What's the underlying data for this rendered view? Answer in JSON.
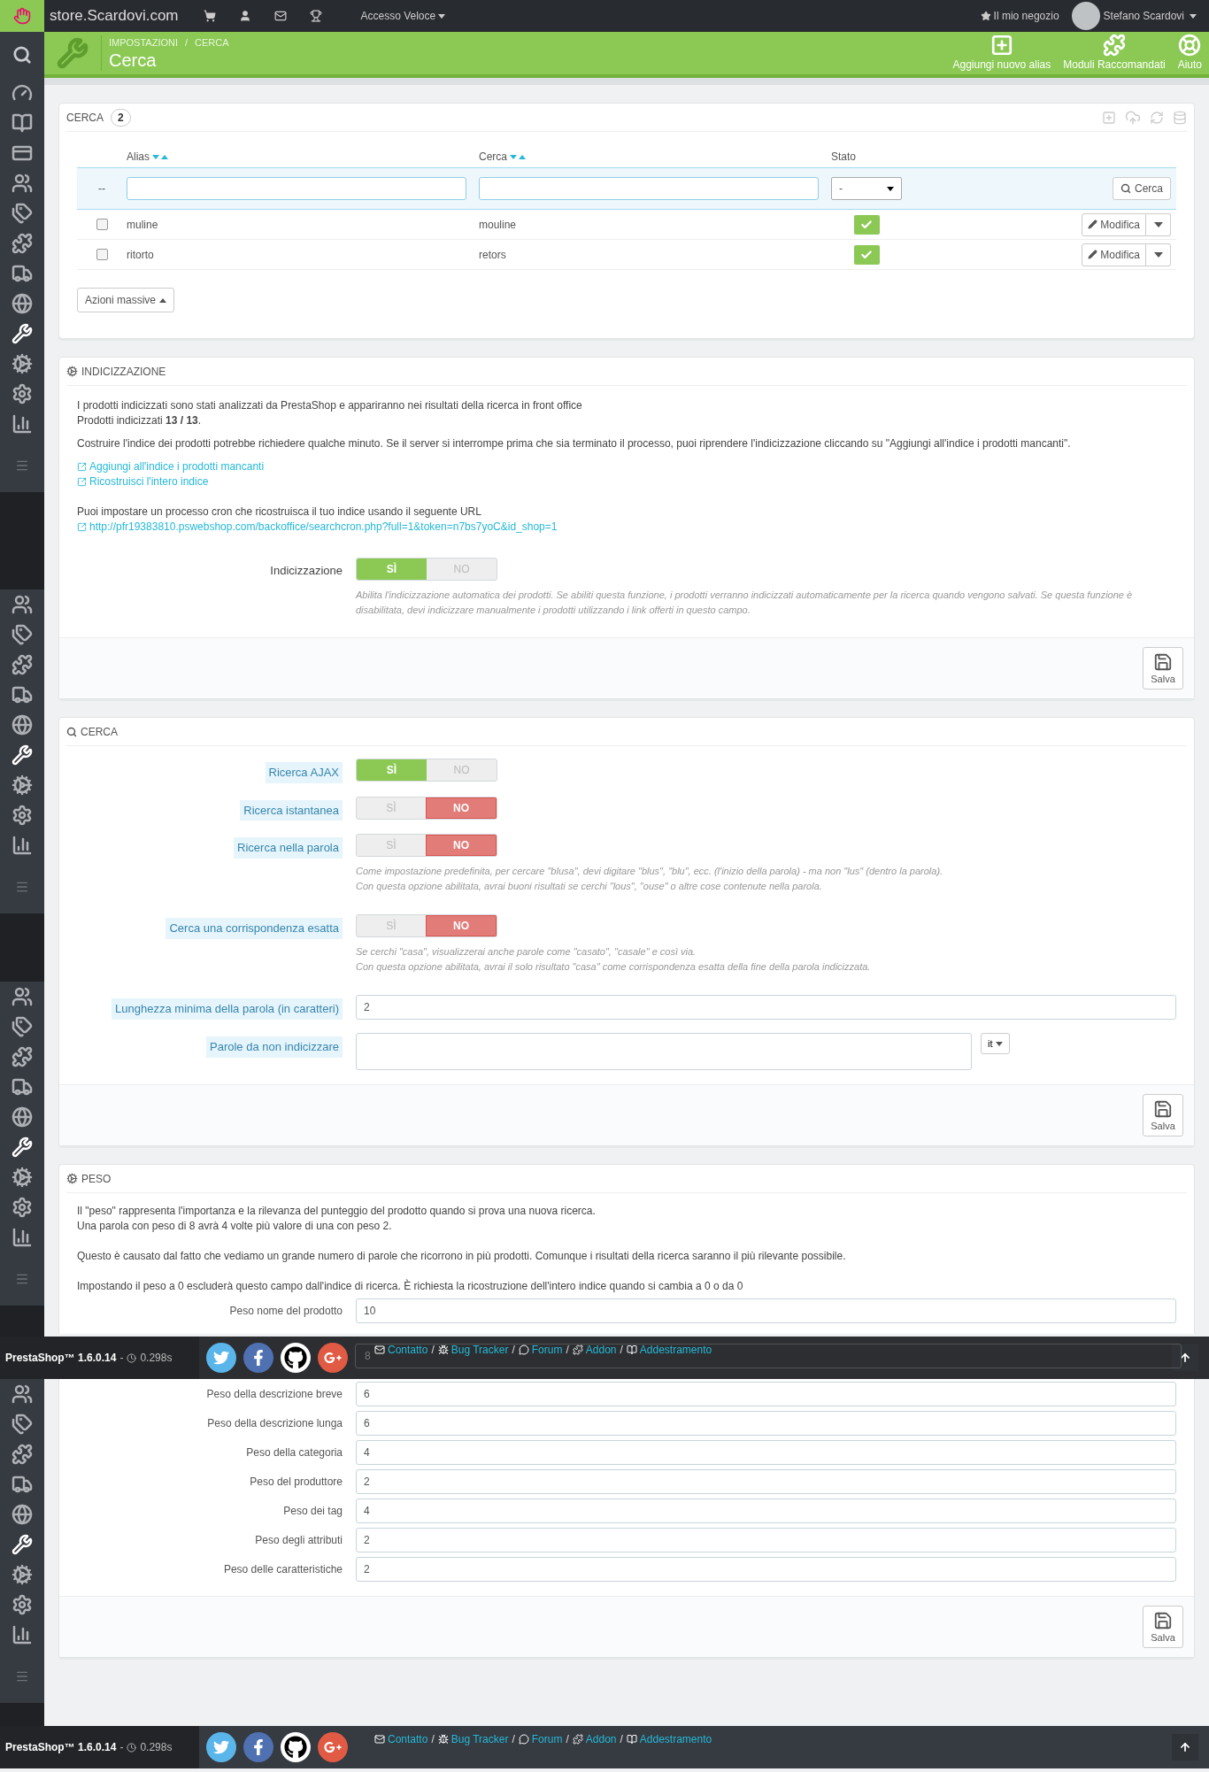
{
  "topbar": {
    "logo_text": "store.Scardovi.com",
    "quick_access": "Accesso Veloce",
    "shop_link": "Il mio negozio",
    "user": "Stefano Scardovi"
  },
  "sidebar": {
    "items": [
      {
        "kind": "dashboard",
        "selected": false
      },
      {
        "kind": "catalog",
        "selected": false
      },
      {
        "kind": "orders",
        "selected": false
      },
      {
        "kind": "customers",
        "selected": false
      },
      {
        "kind": "tags",
        "selected": false
      },
      {
        "kind": "modules",
        "selected": false
      },
      {
        "kind": "shipping",
        "selected": false
      },
      {
        "kind": "localization",
        "selected": false
      },
      {
        "kind": "preferences",
        "selected": true
      },
      {
        "kind": "advanced",
        "selected": false
      },
      {
        "kind": "administration",
        "selected": false
      },
      {
        "kind": "stats",
        "selected": false
      }
    ]
  },
  "page_header": {
    "breadcrumb": [
      "IMPOSTAZIONI",
      "CERCA"
    ],
    "breadcrumb_separator": "/",
    "title": "Cerca",
    "actions": [
      {
        "label": "Aggiungi nuovo alias",
        "kind": "add"
      },
      {
        "label": "Moduli Raccomandati",
        "kind": "modules"
      },
      {
        "label": "Aiuto",
        "kind": "help"
      }
    ]
  },
  "alias_panel": {
    "title": "CERCA",
    "count": "2",
    "columns": [
      {
        "label": "Alias",
        "sortable": true
      },
      {
        "label": "Cerca",
        "sortable": true
      },
      {
        "label": "Stato",
        "sortable": false
      }
    ],
    "filter": {
      "marker": "--",
      "status_value": "-",
      "button": "Cerca"
    },
    "rows": [
      {
        "alias": "muline",
        "search": "mouline",
        "active": true,
        "checked": false,
        "action": "Modifica"
      },
      {
        "alias": "ritorto",
        "search": "retors",
        "active": true,
        "checked": false,
        "action": "Modifica"
      }
    ],
    "bulk_button": "Azioni massive"
  },
  "index_panel": {
    "title": "INDICIZZAZIONE",
    "paragraphs": [
      "I prodotti indicizzati sono stati analizzati da PrestaShop e appariranno nei risultati della ricerca in front office",
      "Prodotti indicizzati **13 / 13**."
    ],
    "note": "Costruire l'indice dei prodotti potrebbe richiedere qualche minuto. Se il server si interrompe prima che sia terminato il processo, puoi riprendere l'indicizzazione cliccando su \"Aggiungi all'indice i prodotti mancanti\".",
    "links": [
      "Aggiungi all'indice i prodotti mancanti",
      "Ricostruisci l'intero indice"
    ],
    "cron_text": "Puoi impostare un processo cron che ricostruisca il tuo indice usando il seguente URL",
    "cron_url": "http://pfr19383810.pswebshop.com/backoffice/searchcron.php?full=1&token=n7bs7yoC&id_shop=1",
    "switch": {
      "label": "Indicizzazione",
      "yes": "SÌ",
      "no": "NO",
      "on": true,
      "help": [
        "Abilita l'indicizzazione automatica dei prodotti. Se abiliti questa funzione, i prodotti verranno indicizzati automaticamente per la ricerca quando vengono salvati. Se questa funzione è disabilitata, devi indicizzare manualmente i prodotti utilizzando i link offerti in questo campo."
      ]
    },
    "save": "Salva"
  },
  "search_panel": {
    "title": "CERCA",
    "fields": [
      {
        "kind": "switch",
        "label": "Ricerca AJAX",
        "yes": "SÌ",
        "no": "NO",
        "on": true
      },
      {
        "kind": "switch",
        "label": "Ricerca istantanea",
        "yes": "SÌ",
        "no": "NO",
        "on": false
      },
      {
        "kind": "switch",
        "label": "Ricerca nella parola",
        "yes": "SÌ",
        "no": "NO",
        "on": false,
        "help": [
          "Come impostazione predefinita, per cercare \"blusa\", devi digitare \"blus\", \"blu\", ecc. (l'inizio della parola) - ma non \"lus\" (dentro la parola).",
          "Con questa opzione abilitata, avrai buoni risultati se cerchi \"lous\", \"ouse\" o altre cose contenute nella parola."
        ]
      },
      {
        "kind": "switch",
        "label": "Cerca una corrispondenza esatta",
        "yes": "SÌ",
        "no": "NO",
        "on": false,
        "help": [
          "Se cerchi \"casa\", visualizzerai anche parole come \"casato\", \"casale\" e così via.",
          "Con questa opzione abilitata, avrai il solo risultato \"casa\" come corrispondenza esatta della fine della parola indicizzata."
        ]
      },
      {
        "kind": "text",
        "label": "Lunghezza minima della parola (in caratteri)",
        "value": "2"
      },
      {
        "kind": "textarea",
        "label": "Parole da non indicizzare",
        "language": "it"
      }
    ],
    "save": "Salva"
  },
  "weight_panel": {
    "title": "PESO",
    "paragraphs": [
      "Il \"peso\" rappresenta l'importanza e la rilevanza del punteggio del prodotto quando si prova una nuova ricerca.",
      "Una parola con peso di 8 avrà 4 volte più valore di una con peso 2.",
      "Questo è causato dal fatto che vediamo un grande numero di parole che ricorrono in più prodotti. Comunque i risultati della ricerca saranno il più rilevante possibile.",
      "Impostando il peso a 0 escluderà questo campo dall'indice di ricerca. È richiesta la ricostruzione dell'intero indice quando si cambia a 0 o da 0"
    ],
    "fields": [
      {
        "label": "Peso nome del prodotto",
        "value": "10"
      },
      {
        "value": "8"
      },
      {
        "label": "Peso della descrizione breve",
        "value": "6"
      },
      {
        "label": "Peso della descrizione lunga",
        "value": "6"
      },
      {
        "label": "Peso della categoria",
        "value": "4"
      },
      {
        "label": "Peso del produttore",
        "value": "2"
      },
      {
        "label": "Peso dei tag",
        "value": "4"
      },
      {
        "label": "Peso degli attributi",
        "value": "2"
      },
      {
        "label": "Peso delle caratteristiche",
        "value": "2"
      }
    ],
    "save": "Salva"
  },
  "footers": [
    {
      "version": "PrestaShop™ 1.6.0.14",
      "dash": "-",
      "load_time": "0.298s",
      "separator": "/",
      "links": [
        {
          "label": "Contatto",
          "kind": "mail"
        },
        {
          "label": "Bug Tracker",
          "kind": "bug"
        },
        {
          "label": "Forum",
          "kind": "forum"
        },
        {
          "label": "Addon",
          "kind": "addon"
        },
        {
          "label": "Addestramento",
          "kind": "training"
        }
      ]
    },
    {
      "version": "PrestaShop™ 1.6.0.14",
      "dash": "-",
      "load_time": "0.298s",
      "separator": "/",
      "links": [
        {
          "label": "Contatto",
          "kind": "mail"
        },
        {
          "label": "Bug Tracker",
          "kind": "bug"
        },
        {
          "label": "Forum",
          "kind": "forum"
        },
        {
          "label": "Addon",
          "kind": "addon"
        },
        {
          "label": "Addestramento",
          "kind": "training"
        }
      ]
    }
  ]
}
